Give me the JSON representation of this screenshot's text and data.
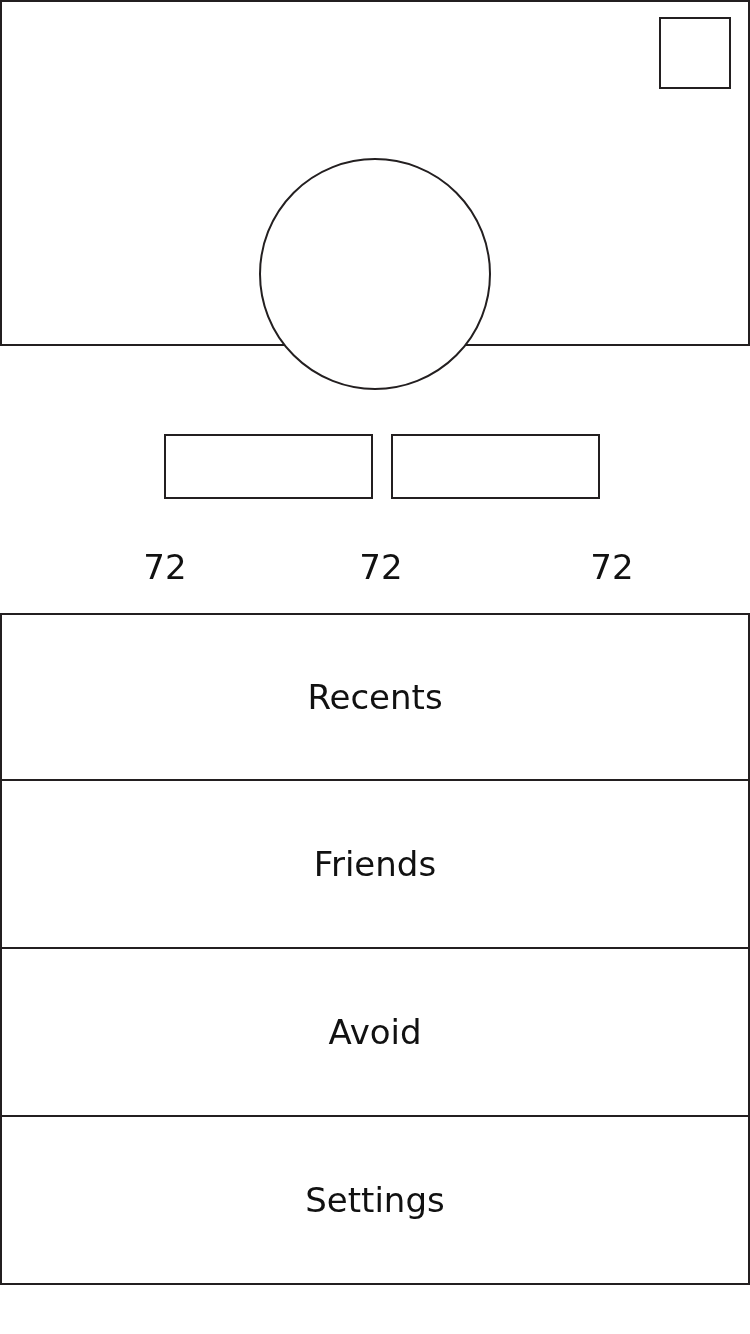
{
  "stats": [
    {
      "value": "72"
    },
    {
      "value": "72"
    },
    {
      "value": "72"
    }
  ],
  "menu": [
    {
      "label": "Recents"
    },
    {
      "label": "Friends"
    },
    {
      "label": "Avoid"
    },
    {
      "label": "Settings"
    }
  ]
}
